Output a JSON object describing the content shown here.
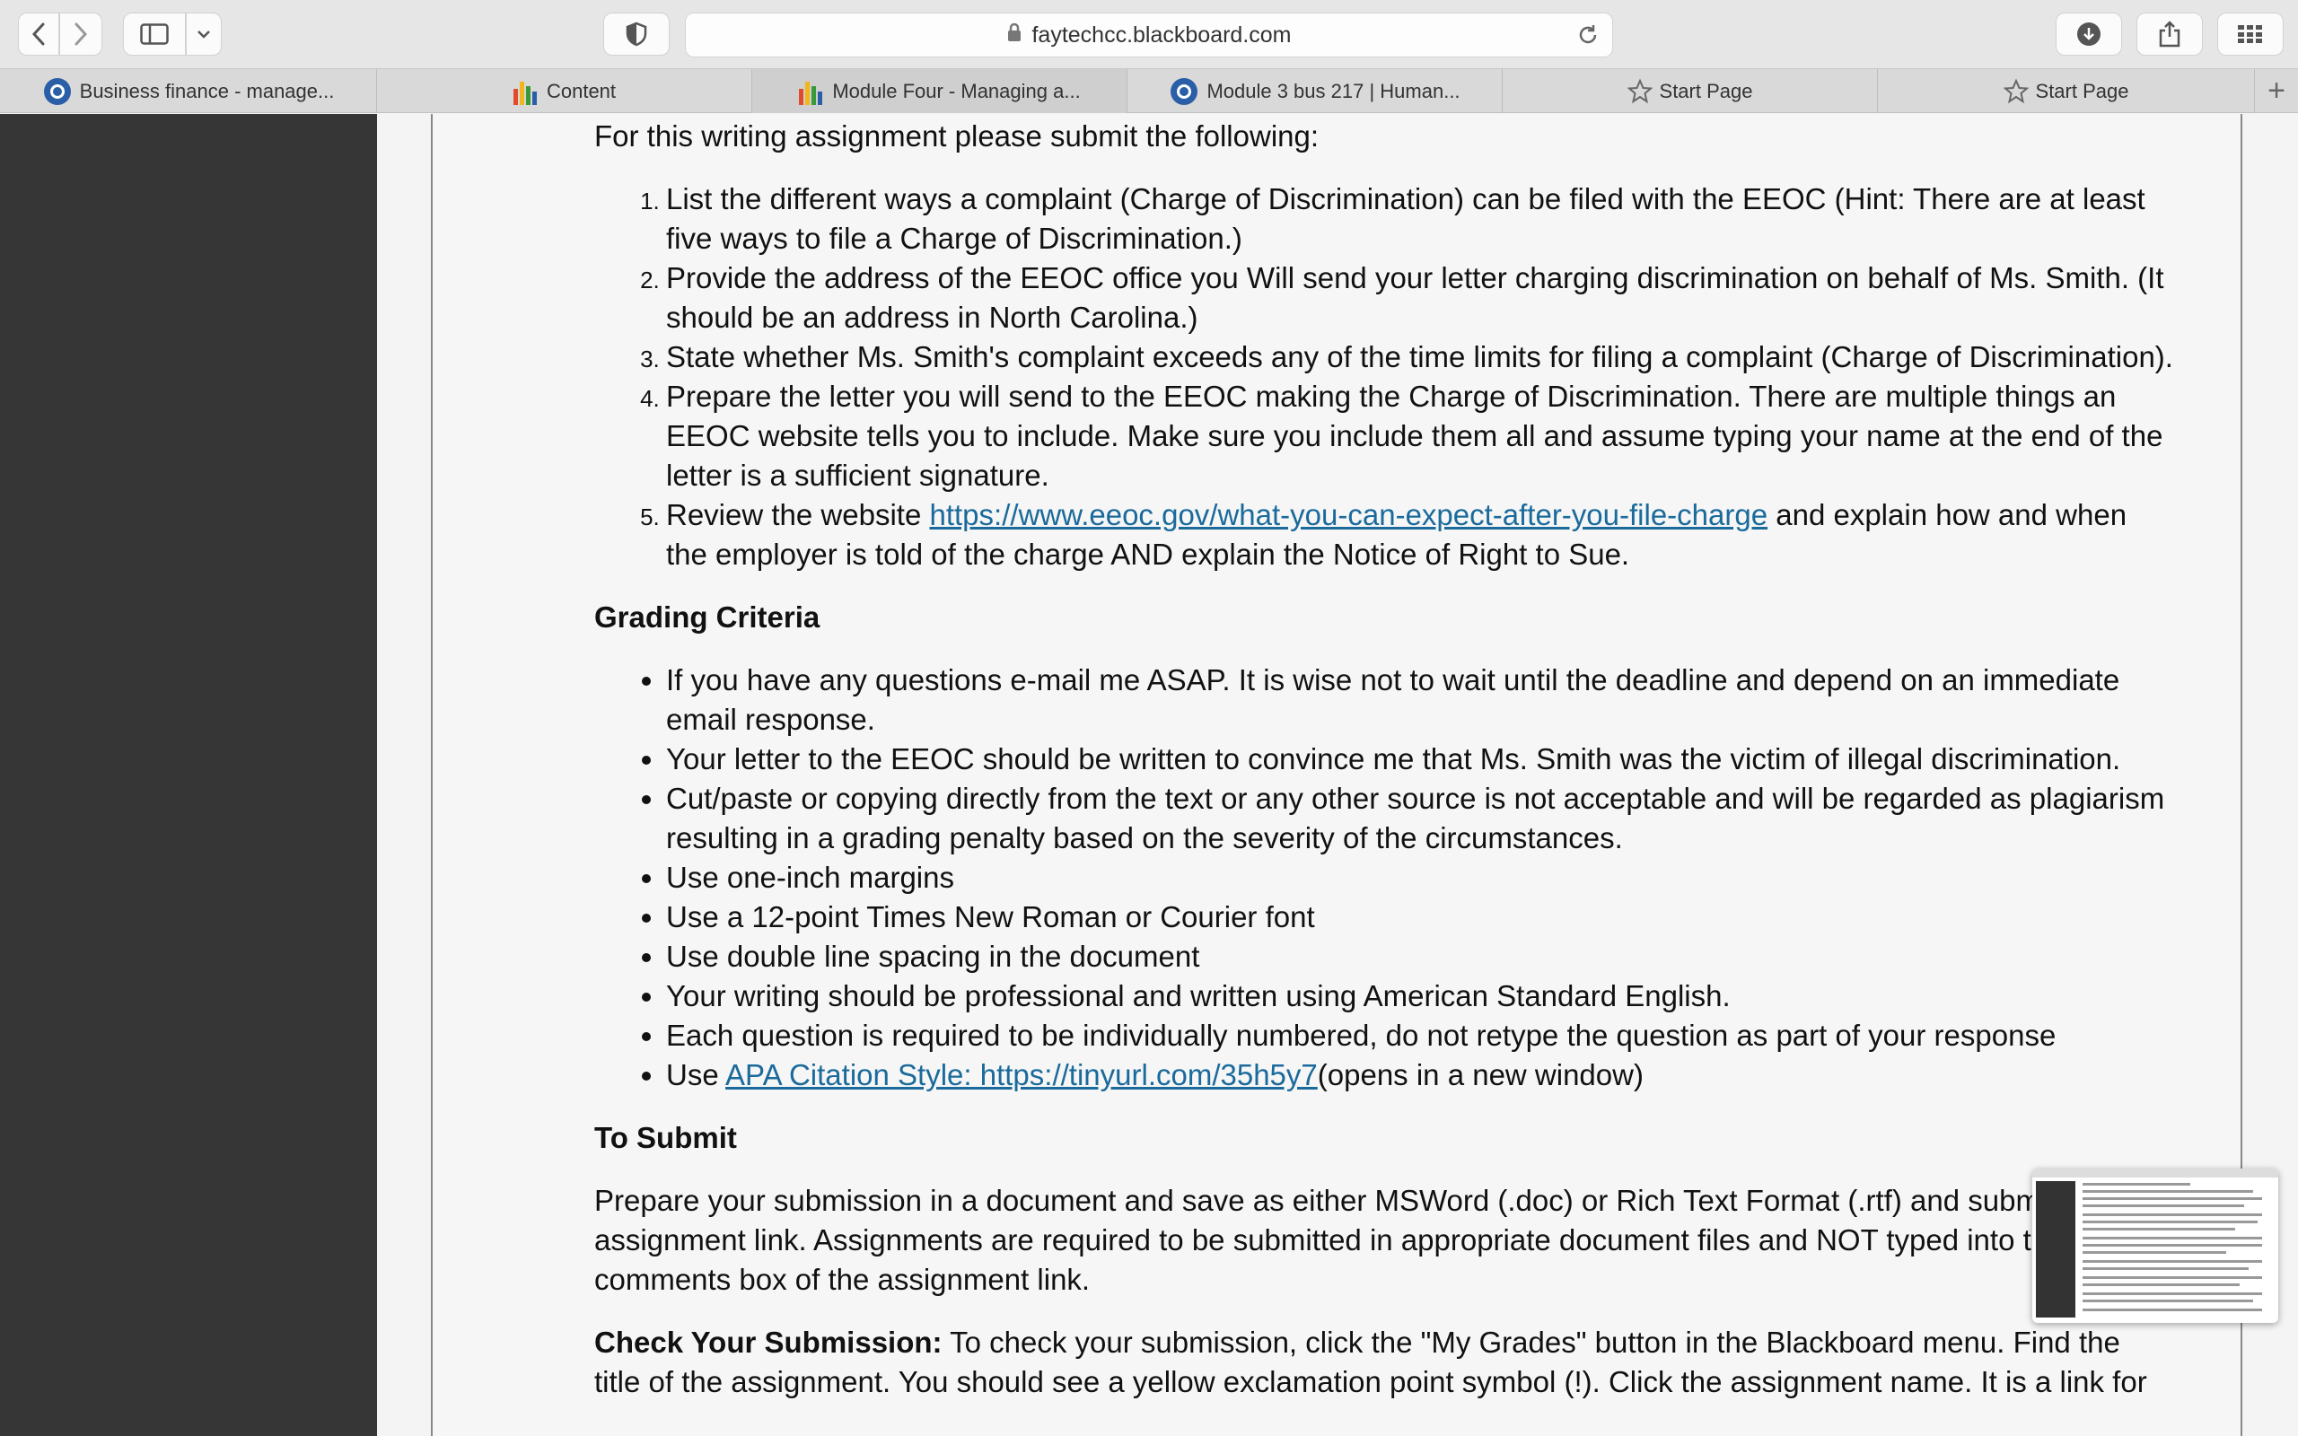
{
  "browser": {
    "url": "faytechcc.blackboard.com",
    "tabs": [
      {
        "label": "Business finance - manage...",
        "icon": "blackboard-logo-icon"
      },
      {
        "label": "Content",
        "icon": "bar-chart-icon"
      },
      {
        "label": "Module Four - Managing a...",
        "icon": "bar-chart-icon"
      },
      {
        "label": "Module 3 bus 217 | Human...",
        "icon": "blackboard-logo-icon"
      },
      {
        "label": "Start Page",
        "icon": "star-icon"
      },
      {
        "label": "Start Page",
        "icon": "star-icon"
      }
    ],
    "new_tab_label": "+"
  },
  "article": {
    "intro": "For this writing assignment please submit the following:",
    "steps": [
      {
        "text": "List the different ways a complaint (Charge of Discrimination) can be filed with the EEOC  (Hint: There are at least five ways to file a Charge of Discrimination.)"
      },
      {
        "text": "Provide the address of the EEOC office you Will send your letter charging discrimination on behalf of Ms. Smith. (It should be an address in North Carolina.)"
      },
      {
        "text": "State whether Ms. Smith's complaint exceeds any of the time limits for filing a complaint (Charge of Discrimination)."
      },
      {
        "text": "Prepare the letter you will send to the EEOC making the Charge of Discrimination.  There are multiple things an EEOC website tells you to include.  Make sure you include them all and assume typing your name at the end of the letter is a sufficient signature."
      },
      {
        "before": "Review the website ",
        "link": "https://www.eeoc.gov/what-you-can-expect-after-you-file-charge",
        "after": " and explain how and when the employer is told of the charge AND explain the Notice of Right to Sue."
      }
    ],
    "grading_heading": "Grading Criteria",
    "grading": [
      "If you have any questions e-mail me ASAP.  It is wise not to wait until the deadline and depend on an immediate email response.",
      "Your letter to the EEOC should be written to convince me that Ms. Smith was the victim of illegal discrimination.",
      "Cut/paste or copying directly from the text or any other source is not acceptable and will be regarded as plagiarism resulting in a grading penalty based on the severity of the circumstances.",
      "Use one-inch margins",
      "Use a 12-point Times New Roman or Courier font",
      "Use double line spacing in the document",
      "Your writing should be professional and written using American Standard English.",
      "Each question is required to be individually numbered, do not retype the question as part of your response"
    ],
    "apa": {
      "before": "Use ",
      "link": " APA Citation Style: https://tinyurl.com/35h5y7",
      "after": "(opens in a new window)"
    },
    "submit_heading": "To Submit",
    "submit_text": "Prepare your submission in a document and save as either MSWord (.doc) or Rich Text Format (.rtf) and submit this assignment link.   Assignments are required to be submitted in appropriate document files and NOT typed into the comments box of the assignment link.",
    "check_label": "Check Your Submission:",
    "check_text": " To check your submission, click the \"My Grades\" button in the Blackboard menu. Find the title of the assignment. You should see a yellow exclamation point symbol (!). Click the assignment name. It is a link for"
  }
}
